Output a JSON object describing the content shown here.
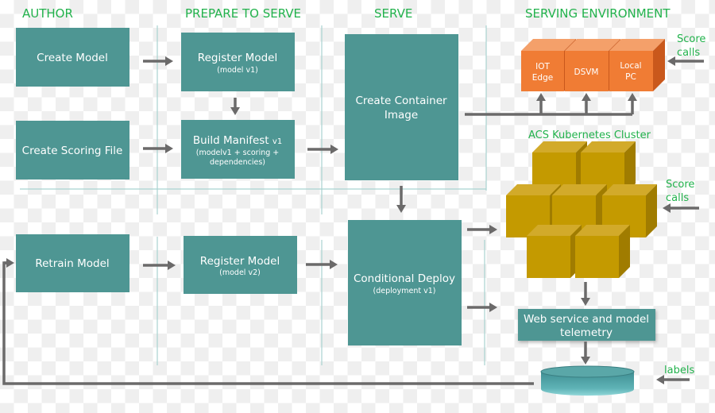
{
  "headers": {
    "author": "AUTHOR",
    "prepare": "PREPARE TO SERVE",
    "serve": "SERVE",
    "serving_env": "SERVING ENVIRONMENT"
  },
  "boxes": {
    "create_model": "Create Model",
    "create_scoring_file": "Create Scoring File",
    "register_model_1": {
      "title": "Register Model",
      "sub": "(model v1)"
    },
    "build_manifest": {
      "title": "Build Manifest",
      "version": "v1",
      "sub1": "(modelv1 + scoring +",
      "sub2": "dependencies)"
    },
    "create_container": {
      "line1": "Create Container",
      "line2": "Image"
    },
    "retrain_model": "Retrain Model",
    "register_model_2": {
      "title": "Register Model",
      "sub": "(model v2)"
    },
    "conditional_deploy": {
      "title": "Conditional Deploy",
      "sub": "(deployment v1)"
    },
    "telemetry": {
      "line1": "Web service and model",
      "line2": "telemetry"
    }
  },
  "targets": {
    "iot": [
      "IOT",
      "Edge"
    ],
    "dsvm": "DSVM",
    "local": [
      "Local",
      "PC"
    ]
  },
  "cluster_label": "ACS Kubernetes Cluster",
  "score_calls": [
    "Score",
    "calls"
  ],
  "labels": "labels",
  "colors": {
    "teal": "#4e9693",
    "orange": "#f07c34",
    "gold": "#c49a00",
    "green_text": "#22b24c",
    "arrow": "#6b6a6a"
  }
}
